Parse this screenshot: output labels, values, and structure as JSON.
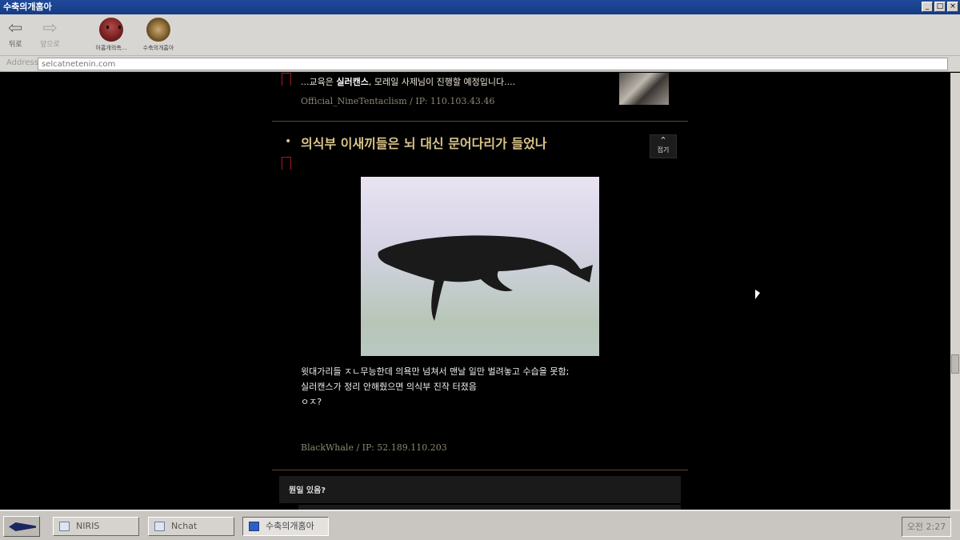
{
  "window": {
    "title": "수축의개홈아",
    "controls": [
      "_",
      "□",
      "×"
    ]
  },
  "toolbar": {
    "back_label": "뒤로",
    "forward_label": "앞으로",
    "favorites": [
      {
        "label": "아홉개의촉...",
        "icon": "octopus-icon"
      },
      {
        "label": "수축의개홈아",
        "icon": "seal-icon"
      }
    ]
  },
  "address": {
    "label": "Address",
    "value": "selcatnetenin.com"
  },
  "previous_post": {
    "text_prefix": "...교육은 ",
    "text_highlight": "실러캔스",
    "text_suffix": ", 모레일 사제님이 진행할 예정입니다....",
    "meta": "Official_NineTentaclism / IP: 110.103.43.46"
  },
  "post": {
    "title": "의식부 이새끼들은 뇌 대신 문어다리가 들었나",
    "fold_label": "접기",
    "image_alt": "whale",
    "body_lines": [
      "윗대가리들 ㅈㄴ무능한데 의욕만 넘쳐서 맨날 일만 벌려놓고 수습을 못함;",
      "실러캔스가 정리 안해줬으면 의식부 진작 터졌음",
      "ㅇㅈ?"
    ],
    "author": "BlackWhale / IP: 52.189.110.203"
  },
  "comment": {
    "text": "뭔일 있음?"
  },
  "taskbar": {
    "tasks": [
      {
        "label": "NIRIS",
        "active": false
      },
      {
        "label": "Nchat",
        "active": false
      },
      {
        "label": "수축의개홈아",
        "active": true
      }
    ],
    "clock": "오전 2:27"
  },
  "colors": {
    "accent_gold": "#d8c489",
    "bookmark_red": "#a21d1d",
    "titlebar_blue": "#1f4a9a"
  }
}
